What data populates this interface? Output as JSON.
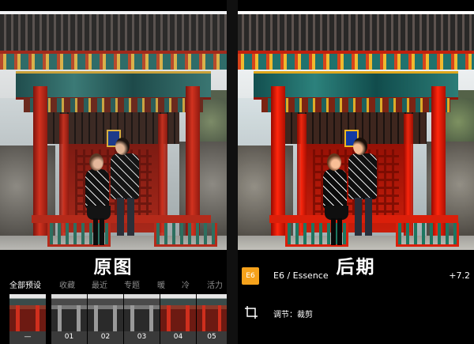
{
  "left": {
    "title": "原图",
    "tabs": [
      {
        "label": "全部预设",
        "active": true
      },
      {
        "label": "收藏",
        "active": false
      },
      {
        "label": "最近",
        "active": false
      },
      {
        "label": "专题",
        "active": false
      },
      {
        "label": "暖",
        "active": false
      },
      {
        "label": "冷",
        "active": false
      },
      {
        "label": "活力",
        "active": false
      }
    ],
    "thumbnails": [
      {
        "label": "—",
        "style": "color"
      },
      {
        "label": "01",
        "style": "bw"
      },
      {
        "label": "02",
        "style": "bw"
      },
      {
        "label": "03",
        "style": "bw"
      },
      {
        "label": "04",
        "style": "color"
      },
      {
        "label": "05",
        "style": "color"
      }
    ]
  },
  "right": {
    "title": "后期",
    "preset_badge": "E6",
    "preset_name": "E6 / Essence",
    "preset_value": "+7.2",
    "crop_label": "调节：裁剪",
    "accent_color": "#f6a21b"
  }
}
